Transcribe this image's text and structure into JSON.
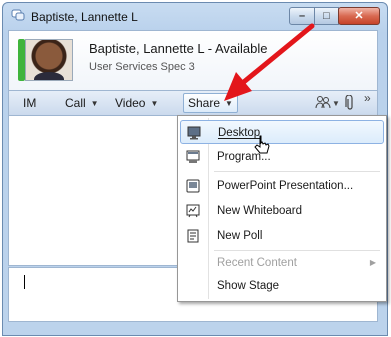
{
  "window": {
    "title": "Baptiste, Lannette L",
    "controls": {
      "minimize": "–",
      "maximize": "□",
      "close": "✕"
    }
  },
  "contact": {
    "name_status": "Baptiste, Lannette L - Available",
    "title": "User Services Spec 3",
    "presence_color": "#3fb43c"
  },
  "toolbar": {
    "im": "IM",
    "call": "Call",
    "video": "Video",
    "share": "Share",
    "people_icon": "people-icon",
    "attach_icon": "paperclip-icon",
    "overflow": "»"
  },
  "share_menu": {
    "items": [
      {
        "label": "Desktop",
        "icon": "monitor-icon",
        "state": "hover"
      },
      {
        "label": "Program...",
        "icon": "program-icon"
      },
      {
        "label": "PowerPoint Presentation...",
        "icon": "presentation-icon"
      },
      {
        "label": "New Whiteboard",
        "icon": "whiteboard-icon"
      },
      {
        "label": "New Poll",
        "icon": "poll-icon"
      },
      {
        "label": "Recent Content",
        "icon": "",
        "state": "disabled",
        "submenu": true
      },
      {
        "label": "Show Stage",
        "icon": ""
      }
    ]
  },
  "colors": {
    "highlight": "#dcecfb",
    "annotation_arrow": "#e3161b"
  }
}
